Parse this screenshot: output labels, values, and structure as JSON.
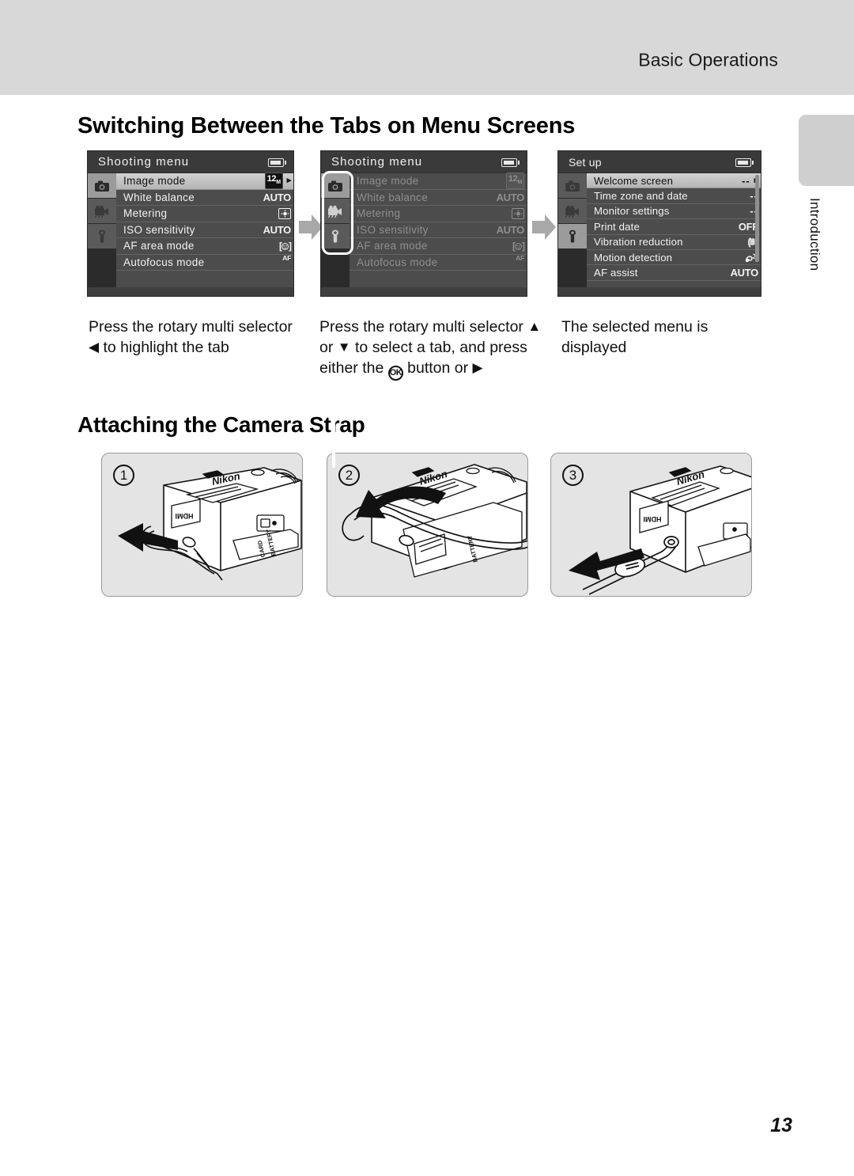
{
  "header": {
    "section_title": "Basic Operations"
  },
  "side_index": {
    "label": "Introduction"
  },
  "headings": {
    "tabs_section": "Switching Between the Tabs on Menu Screens",
    "strap_section": "Attaching the Camera Strap"
  },
  "screens": [
    {
      "title": "Shooting menu",
      "battery_icon": "battery-icon",
      "tabs": [
        {
          "icon": "camera-icon",
          "active": true
        },
        {
          "icon": "movie-camera-icon",
          "active": false
        },
        {
          "icon": "wrench-icon",
          "active": false
        }
      ],
      "tab_rail_highlighted": false,
      "rows_dimmed": false,
      "rows": [
        {
          "label": "Image mode",
          "value": "12M",
          "value_kind": "image-mode",
          "selected": true,
          "caret": "▸"
        },
        {
          "label": "White balance",
          "value": "AUTO",
          "value_kind": "text",
          "selected": false
        },
        {
          "label": "Metering",
          "value": "",
          "value_kind": "metering",
          "selected": false
        },
        {
          "label": "ISO sensitivity",
          "value": "AUTO",
          "value_kind": "text",
          "selected": false
        },
        {
          "label": "AF area mode",
          "value": "",
          "value_kind": "af-area",
          "selected": false
        },
        {
          "label": "Autofocus mode",
          "value": "AF S",
          "value_kind": "af-mode",
          "selected": false
        }
      ]
    },
    {
      "title": "Shooting menu",
      "battery_icon": "battery-icon",
      "tabs": [
        {
          "icon": "camera-icon",
          "active": true
        },
        {
          "icon": "movie-camera-icon",
          "active": false
        },
        {
          "icon": "wrench-icon",
          "active": false
        }
      ],
      "tab_rail_highlighted": true,
      "rows_dimmed": true,
      "rows": [
        {
          "label": "Image mode",
          "value": "12M",
          "value_kind": "image-mode",
          "selected": false
        },
        {
          "label": "White balance",
          "value": "AUTO",
          "value_kind": "text",
          "selected": false
        },
        {
          "label": "Metering",
          "value": "",
          "value_kind": "metering",
          "selected": false
        },
        {
          "label": "ISO sensitivity",
          "value": "AUTO",
          "value_kind": "text",
          "selected": false
        },
        {
          "label": "AF area mode",
          "value": "",
          "value_kind": "af-area",
          "selected": false
        },
        {
          "label": "Autofocus mode",
          "value": "AF S",
          "value_kind": "af-mode",
          "selected": false
        }
      ]
    },
    {
      "title": "Set up",
      "battery_icon": "battery-icon",
      "tabs": [
        {
          "icon": "camera-icon",
          "active": false
        },
        {
          "icon": "movie-camera-icon",
          "active": false
        },
        {
          "icon": "wrench-icon",
          "active": true
        }
      ],
      "tab_rail_highlighted": false,
      "rows_dimmed": false,
      "rows": [
        {
          "label": "Welcome screen",
          "value": "--",
          "value_kind": "dashes",
          "selected": true,
          "caret": "▸"
        },
        {
          "label": "Time zone and date",
          "value": "--",
          "value_kind": "dashes",
          "selected": false
        },
        {
          "label": "Monitor settings",
          "value": "--",
          "value_kind": "dashes",
          "selected": false
        },
        {
          "label": "Print date",
          "value": "OFF",
          "value_kind": "text",
          "selected": false
        },
        {
          "label": "Vibration reduction",
          "value": "",
          "value_kind": "vr",
          "selected": false
        },
        {
          "label": "Motion detection",
          "value": "",
          "value_kind": "motion",
          "selected": false
        },
        {
          "label": "AF assist",
          "value": "AUTO",
          "value_kind": "text",
          "selected": false
        }
      ]
    }
  ],
  "captions": [
    {
      "parts": [
        "Press the rotary multi selector ",
        "◀",
        " to highlight the tab"
      ]
    },
    {
      "parts": [
        "Press the rotary multi selector ",
        "▲",
        " or ",
        "▼",
        " to select a tab, and press either the ",
        "OK",
        " button or ",
        "▶"
      ]
    },
    {
      "parts": [
        "The selected menu is displayed"
      ]
    }
  ],
  "caption_text": {
    "c1_a": "Press the rotary multi selector ",
    "c1_left": "◀",
    "c1_b": " to highlight the tab",
    "c2_a": "Press the rotary multi selector ",
    "c2_up": "▲",
    "c2_or": " or ",
    "c2_down": "▼",
    "c2_b": " to select a tab, and press either the ",
    "c2_ok": "OK",
    "c2_c": " button or ",
    "c2_right": "▶",
    "c3": "The selected menu is displayed"
  },
  "strap_figures": [
    {
      "number": "1",
      "port_labels": [
        "HDMI",
        "BATTERY",
        "CARD"
      ],
      "brand": "Nikon",
      "arrow_direction": "left",
      "description": "Thread the thin strap loop through the camera eyelet"
    },
    {
      "number": "2",
      "port_labels": [
        "BATTERY"
      ],
      "brand": "Nikon",
      "arrow_direction": "left-curve",
      "description": "Pass the strap through the loop"
    },
    {
      "number": "3",
      "port_labels": [
        "HDMI"
      ],
      "brand": "Nikon",
      "arrow_direction": "left",
      "description": "Pull the strap tight to secure it"
    }
  ],
  "page_number": "13",
  "colors": {
    "header_band": "#d8d8d8",
    "side_tab": "#cfcfcf",
    "lcd_background": "#4c4c4c",
    "lcd_titlebar": "#3a3a3a",
    "tab_rail": "#2b2b2b",
    "tab_active": "#9b9b9b",
    "selected_row": "#c6c6c6",
    "figure_background": "#e4e4e4",
    "arrow_gray": "#a8a8a8"
  }
}
